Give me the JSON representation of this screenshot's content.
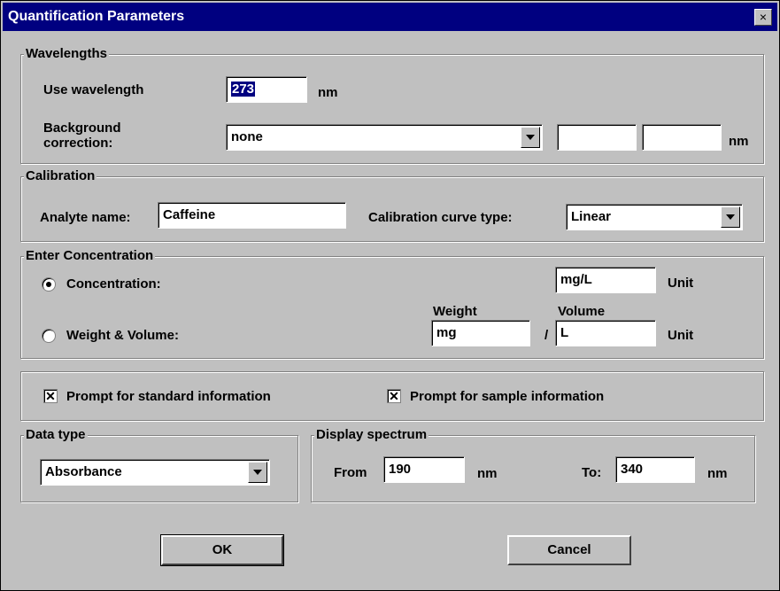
{
  "window": {
    "title": "Quantification Parameters",
    "close_glyph": "×"
  },
  "wavelengths": {
    "group_title": "Wavelengths",
    "use_wavelength_label": "Use wavelength",
    "use_wavelength_value": "273",
    "use_wavelength_unit": "nm",
    "background_label_line1": "Background",
    "background_label_line2": "correction:",
    "background_value": "none",
    "background_field1": "",
    "background_field2": "",
    "background_unit": "nm"
  },
  "calibration": {
    "group_title": "Calibration",
    "analyte_label": "Analyte name:",
    "analyte_value": "Caffeine",
    "curve_label": "Calibration curve type:",
    "curve_value": "Linear"
  },
  "concentration": {
    "group_title": "Enter Concentration",
    "option_concentration": "Concentration:",
    "option_concentration_selected": true,
    "concentration_unit_value": "mg/L",
    "unit_label": "Unit",
    "option_weight_volume": "Weight & Volume:",
    "weight_header": "Weight",
    "volume_header": "Volume",
    "weight_value": "mg",
    "separator": "/",
    "volume_value": "L",
    "unit_label_2": "Unit"
  },
  "prompts": {
    "standard_label": "Prompt for standard information",
    "standard_checked": true,
    "sample_label": "Prompt for sample information",
    "sample_checked": true,
    "check_glyph": "✕"
  },
  "data_type": {
    "group_title": "Data type",
    "value": "Absorbance"
  },
  "display_spectrum": {
    "group_title": "Display spectrum",
    "from_label": "From",
    "from_value": "190",
    "from_unit": "nm",
    "to_label": "To:",
    "to_value": "340",
    "to_unit": "nm"
  },
  "buttons": {
    "ok": "OK",
    "cancel": "Cancel"
  }
}
